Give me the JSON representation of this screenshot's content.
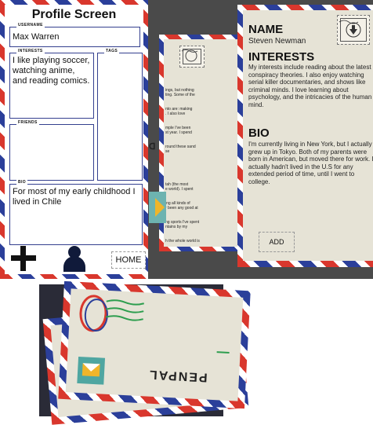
{
  "profile": {
    "title": "Profile Screen",
    "username_label": "USERNAME",
    "username_value": "Max Warren",
    "interests_label": "INTERESTS",
    "interests_value": "I like playing soccer, watching anime, and reading comics.",
    "tags_label": "TAGS",
    "friends_label": "FRIENDS",
    "bio_label": "BIO",
    "bio_value": "For most of my early childhood I lived in Chile",
    "home_label": "HOME"
  },
  "profile_card": {
    "name_heading": "NAME",
    "name_value": "Steven Newman",
    "interests_heading": "INTERESTS",
    "interests_value": "My interests include reading about the latest conspiracy theories. I also enjoy watching serial killer documentaries, and shows like criminal minds. I love learning about psychology, and the intricacies of the human mind.",
    "bio_heading": "BIO",
    "bio_value": "I'm currently living in New York, but I actually grew up in Tokyo. Both of my parents were born in American, but moved there for work. I actually hadn't lived in the U.S for any extended period of time, until I went to college.",
    "add_label": "ADD"
  },
  "partial_card": {
    "lines_top": [
      "ings, but nothing",
      "ting. Some of the",
      "nto are: making",
      ". I also love",
      "mple I've been",
      "st year. I spend",
      "round these sand",
      "se"
    ],
    "lines_bottom": [
      "tah (the most",
      "e world). I spent",
      "ing all kinds of",
      "r been any good at",
      "ng sports I've spent",
      "ntains by my",
      "h the whole world is"
    ]
  },
  "envelope": {
    "logo_text": "PENPAL"
  },
  "colors": {
    "airmail_red": "#d9372d",
    "airmail_blue": "#2b3f9a",
    "paper": "#e6e3d6",
    "backdrop": "#4a4a4a"
  }
}
